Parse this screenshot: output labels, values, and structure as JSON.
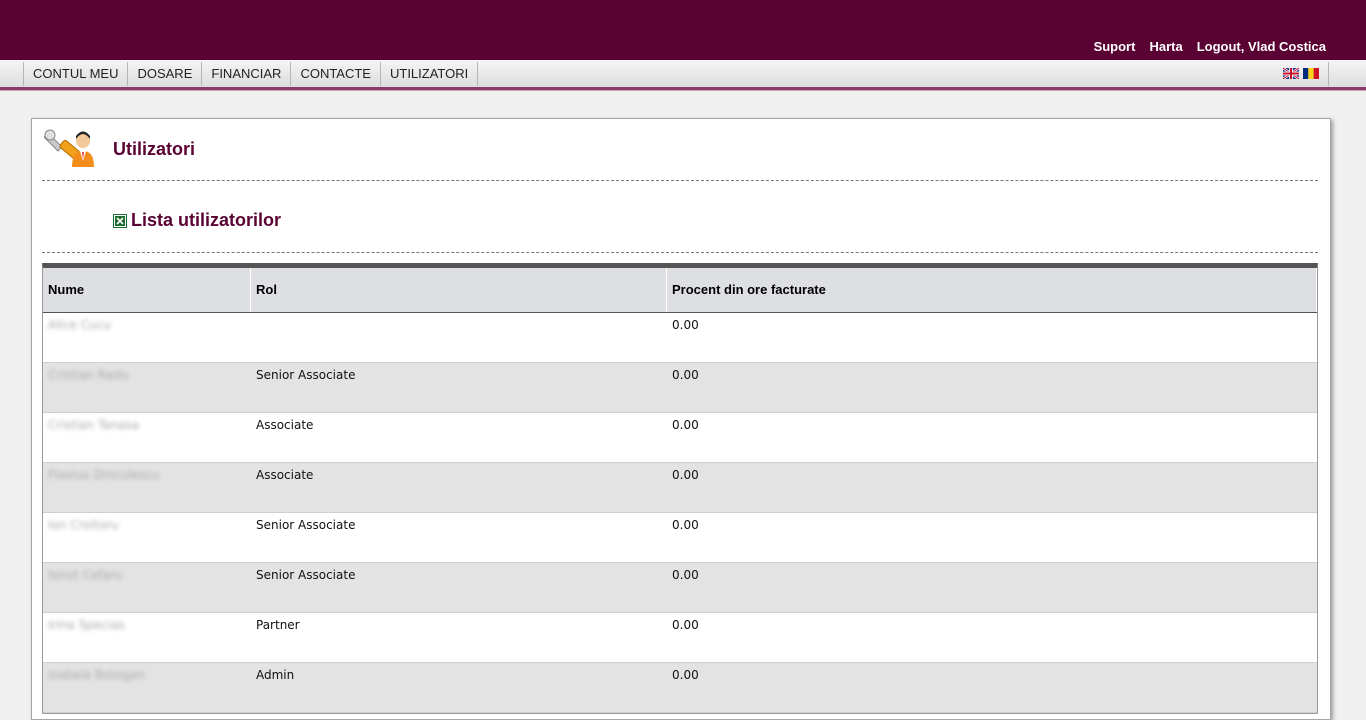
{
  "header": {
    "links": [
      "Suport",
      "Harta",
      "Logout, Vlad Costica"
    ]
  },
  "nav": {
    "items": [
      "CONTUL MEU",
      "DOSARE",
      "FINANCIAR",
      "CONTACTE",
      "UTILIZATORI"
    ],
    "flags": [
      "uk-flag-icon",
      "romania-flag-icon"
    ]
  },
  "page": {
    "title": "Utilizatori",
    "icon": "users-tools-icon",
    "section_title": "Lista utilizatorilor",
    "export_icon": "excel-export-icon"
  },
  "table": {
    "headers": [
      "Nume",
      "Rol",
      "Procent din ore facturate"
    ],
    "rows": [
      {
        "name": "Alice Cucu",
        "role": "",
        "percent": "0.00"
      },
      {
        "name": "Cristian Radu",
        "role": "Senior Associate",
        "percent": "0.00"
      },
      {
        "name": "Cristian Tanasa",
        "role": "Associate",
        "percent": "0.00"
      },
      {
        "name": "Flavius Dinculescu",
        "role": "Associate",
        "percent": "0.00"
      },
      {
        "name": "Ion Croitoru",
        "role": "Senior Associate",
        "percent": "0.00"
      },
      {
        "name": "Ionut Cefaru",
        "role": "Senior Associate",
        "percent": "0.00"
      },
      {
        "name": "Irina Specias",
        "role": "Partner",
        "percent": "0.00"
      },
      {
        "name": "Izabela Botogan",
        "role": "Admin",
        "percent": "0.00"
      }
    ]
  },
  "colors": {
    "brand": "#5a0233",
    "row_alt": "#e3e3e3",
    "header_bg": "#dedfe3"
  }
}
